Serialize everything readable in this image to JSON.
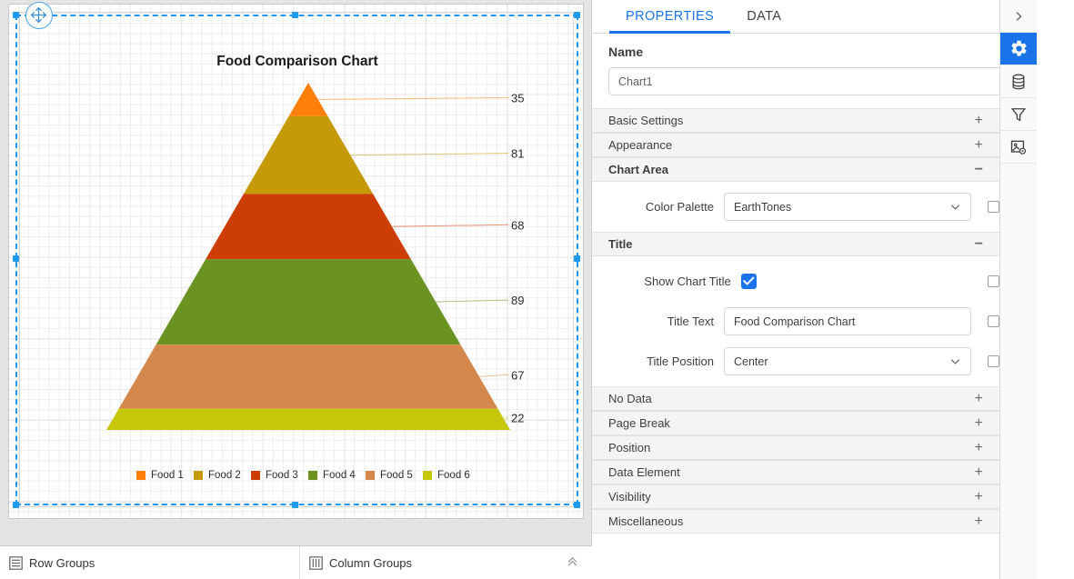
{
  "canvas": {
    "chart": {
      "title": "Food Comparison Chart",
      "legend": [
        "Food 1",
        "Food 2",
        "Food 3",
        "Food 4",
        "Food 5",
        "Food 6"
      ]
    }
  },
  "chart_data": {
    "type": "pyramid",
    "title": "Food Comparison Chart",
    "categories": [
      "Food 1",
      "Food 2",
      "Food 3",
      "Food 4",
      "Food 5",
      "Food 6"
    ],
    "values": [
      35,
      81,
      68,
      89,
      67,
      22
    ],
    "labels": [
      "35",
      "81",
      "68",
      "89",
      "67",
      "22"
    ],
    "colors": [
      "#FF8008",
      "#C49A06",
      "#CC3E06",
      "#6B9322",
      "#D4884B",
      "#C6C708"
    ],
    "legend_position": "bottom",
    "grid": true,
    "xlabel": "",
    "ylabel": ""
  },
  "group_bar": {
    "row_groups": "Row Groups",
    "column_groups": "Column Groups"
  },
  "panel": {
    "tabs": [
      {
        "label": "PROPERTIES",
        "active": true
      },
      {
        "label": "DATA",
        "active": false
      }
    ],
    "name_label": "Name",
    "name_value": "Chart1",
    "sections": [
      {
        "label": "Basic Settings",
        "sign": "+"
      },
      {
        "label": "Appearance",
        "sign": "+"
      },
      {
        "label": "Chart Area",
        "sign": "−"
      }
    ],
    "chart_area": {
      "color_palette_label": "Color Palette",
      "color_palette_value": "EarthTones"
    },
    "title_section": {
      "label": "Title",
      "sign": "−",
      "show_chart_title_label": "Show Chart Title",
      "show_chart_title_checked": true,
      "title_text_label": "Title Text",
      "title_text_value": "Food Comparison Chart",
      "title_position_label": "Title Position",
      "title_position_value": "Center"
    },
    "bottom_sections": [
      {
        "label": "No Data",
        "sign": "+"
      },
      {
        "label": "Page Break",
        "sign": "+"
      },
      {
        "label": "Position",
        "sign": "+"
      },
      {
        "label": "Data Element",
        "sign": "+"
      },
      {
        "label": "Visibility",
        "sign": "+"
      },
      {
        "label": "Miscellaneous",
        "sign": "+"
      }
    ]
  },
  "rail": {
    "items": [
      {
        "icon": "chevron-right-icon",
        "active": false
      },
      {
        "icon": "gear-icon",
        "active": true
      },
      {
        "icon": "database-icon",
        "active": false
      },
      {
        "icon": "filter-icon",
        "active": false
      },
      {
        "icon": "image-settings-icon",
        "active": false
      }
    ]
  },
  "colors": {
    "accent": "#1a73e8",
    "selection": "#2196f3"
  }
}
